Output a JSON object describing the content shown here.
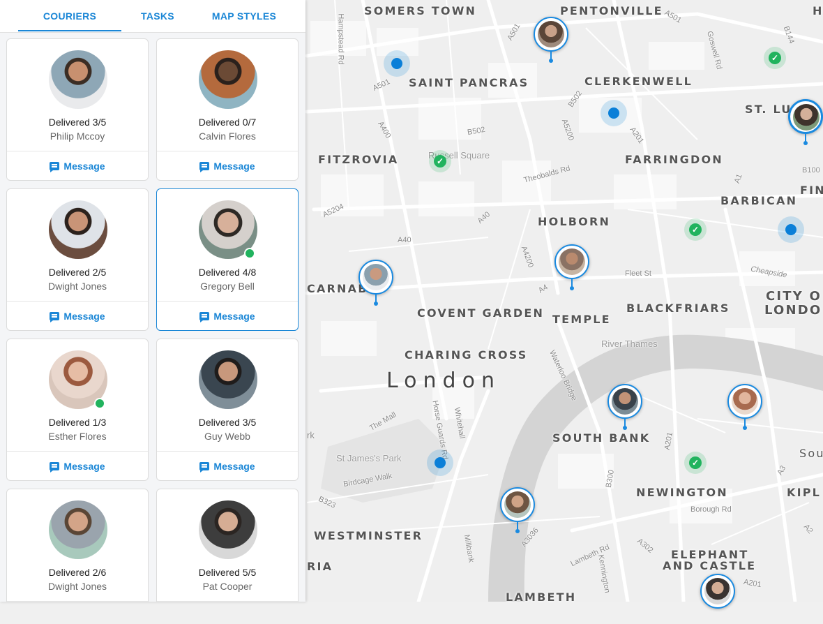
{
  "tabs": [
    {
      "label": "COURIERS",
      "active": true
    },
    {
      "label": "TASKS",
      "active": false
    },
    {
      "label": "MAP STYLES",
      "active": false
    }
  ],
  "couriers": [
    {
      "name": "Philip Mccoy",
      "delivered": "Delivered 3/5",
      "online": false,
      "selected": false,
      "message_label": "Message"
    },
    {
      "name": "Calvin Flores",
      "delivered": "Delivered 0/7",
      "online": false,
      "selected": false,
      "message_label": "Message"
    },
    {
      "name": "Dwight Jones",
      "delivered": "Delivered 2/5",
      "online": false,
      "selected": false,
      "message_label": "Message"
    },
    {
      "name": "Gregory Bell",
      "delivered": "Delivered 4/8",
      "online": true,
      "selected": true,
      "message_label": "Message"
    },
    {
      "name": "Esther Flores",
      "delivered": "Delivered 1/3",
      "online": true,
      "selected": false,
      "message_label": "Message"
    },
    {
      "name": "Guy Webb",
      "delivered": "Delivered 3/5",
      "online": false,
      "selected": false,
      "message_label": "Message"
    },
    {
      "name": "Dwight Jones",
      "delivered": "Delivered 2/6",
      "online": false,
      "selected": false,
      "message_label": "Message"
    },
    {
      "name": "Pat Cooper",
      "delivered": "Delivered 5/5",
      "online": false,
      "selected": false,
      "message_label": "Message"
    }
  ],
  "map": {
    "city_label": "London",
    "districts": [
      "SOMERS TOWN",
      "PENTONVILLE",
      "SAINT PANCRAS",
      "CLERKENWELL",
      "ST. LU",
      "FITZROVIA",
      "FARRINGDON",
      "FIN",
      "BARBICAN",
      "HOLBORN",
      "CARNAB",
      "COVENT GARDEN",
      "TEMPLE",
      "BLACKFRIARS",
      "CITY O",
      "LONDO",
      "CHARING CROSS",
      "SOUTH BANK",
      "Sou",
      "NEWINGTON",
      "KIPL",
      "WESTMINSTER",
      "ELEPHANT",
      "AND CASTLE",
      "LAMBETH",
      "RIA",
      "H"
    ],
    "roads": [
      "A501",
      "A501",
      "Hampstead Rd",
      "A501",
      "Goswell Rd",
      "B144",
      "B502",
      "A400",
      "B502",
      "A5200",
      "A201",
      "Russell Square",
      "Theobalds Rd",
      "B100",
      "A1",
      "A5204",
      "A40",
      "A40",
      "A4200",
      "A4",
      "Fleet St",
      "Cheapside",
      "River Thames",
      "Waterloo Bridge",
      "The Mall",
      "Horse Guards Rd",
      "Whitehall",
      "St James's Park",
      "Birdcage Walk",
      "B323",
      "A201",
      "B300",
      "Borough Rd",
      "A3",
      "A3036",
      "Millbank",
      "Lambeth Rd",
      "Kennington",
      "A302",
      "A201",
      "A2",
      "rk"
    ]
  },
  "colors": {
    "accent": "#1a86d6",
    "online": "#21b35e",
    "delivered_check": "#21b35e"
  }
}
